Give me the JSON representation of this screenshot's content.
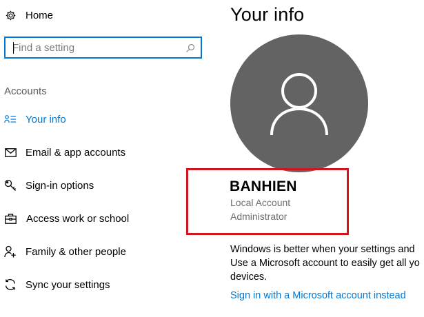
{
  "sidebar": {
    "home_label": "Home",
    "search": {
      "placeholder": "Find a setting"
    },
    "section_title": "Accounts",
    "items": [
      {
        "label": "Your info",
        "icon": "person-list-icon",
        "active": true
      },
      {
        "label": "Email & app accounts",
        "icon": "mail-icon",
        "active": false
      },
      {
        "label": "Sign-in options",
        "icon": "key-icon",
        "active": false
      },
      {
        "label": "Access work or school",
        "icon": "briefcase-icon",
        "active": false
      },
      {
        "label": "Family & other people",
        "icon": "person-add-icon",
        "active": false
      },
      {
        "label": "Sync your settings",
        "icon": "sync-icon",
        "active": false
      }
    ]
  },
  "main": {
    "title": "Your info",
    "user": {
      "name": "BANHIEN",
      "account_type": "Local Account",
      "role": "Administrator"
    },
    "description": [
      "Windows is better when your settings and",
      "Use a Microsoft account to easily get all yo",
      "devices."
    ],
    "link": "Sign in with a Microsoft account instead"
  },
  "colors": {
    "accent": "#0078d7",
    "highlight": "#d0161d",
    "avatar_bg": "#636363"
  }
}
